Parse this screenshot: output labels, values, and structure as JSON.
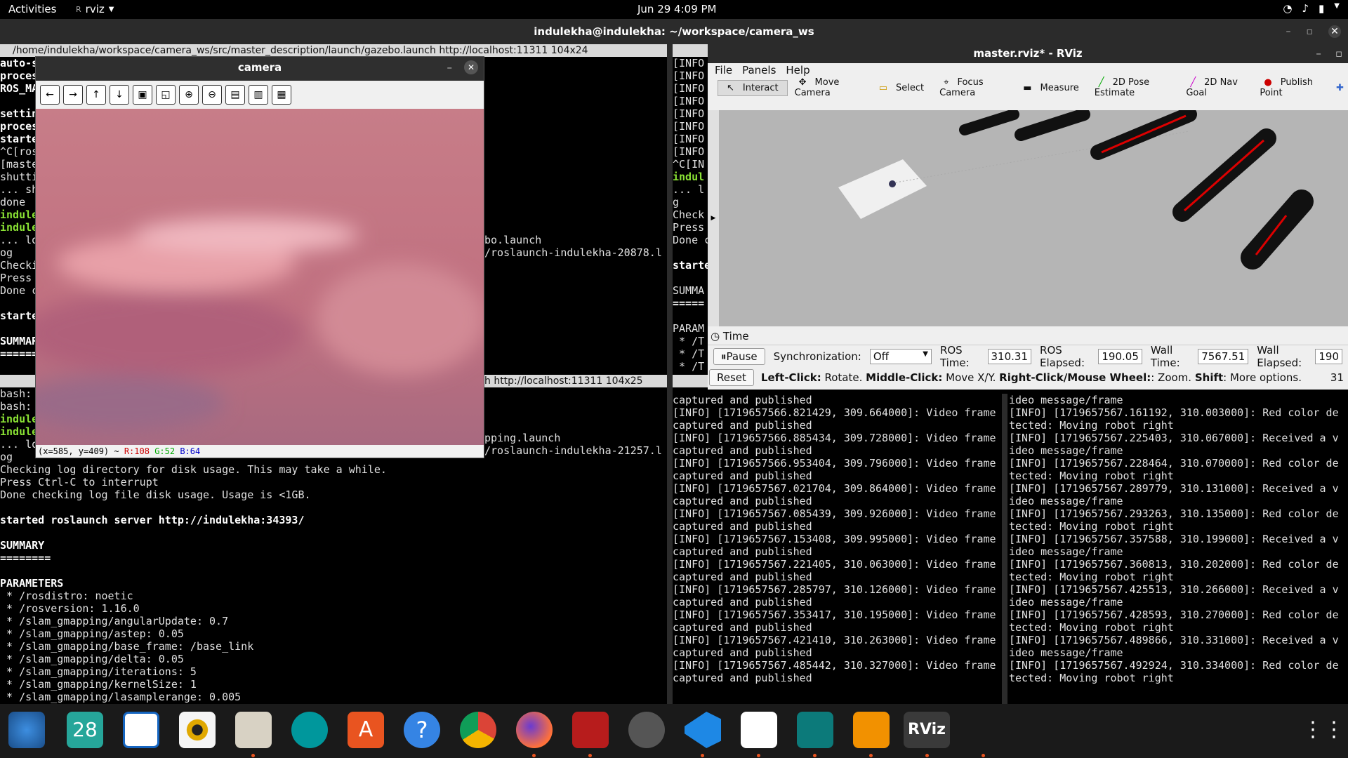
{
  "topbar": {
    "activities": "Activities",
    "app": "rviz",
    "clock": "Jun 29  4:09 PM"
  },
  "terminal_window": {
    "title": "indulekha@indulekha: ~/workspace/camera_ws"
  },
  "term1": {
    "header": "/home/indulekha/workspace/camera_ws/src/master_description/launch/gazebo.launch http://localhost:11311 104x24",
    "lines": [
      "auto-s",
      "proces",
      "ROS_MA",
      "",
      "settin",
      "proces",
      "starte",
      "^C[ros",
      "[maste",
      "shutti",
      "... sh",
      "done",
      "indule",
      "indule",
      "... lo",
      "og",
      "Checki",
      "Press",
      "Done c",
      "",
      "starte",
      "",
      "SUMMAR",
      "======"
    ],
    "right_lines": [
      "",
      "",
      "",
      "",
      "",
      "",
      "",
      "",
      "",
      "",
      "",
      "",
      "",
      "",
      "bo.launch",
      "/roslaunch-indulekha-20878.l"
    ]
  },
  "term2": {
    "header": "h http://localhost:11311 104x25",
    "lines": [
      "bash:",
      "bash:",
      "indule",
      "indule",
      "... lo",
      "og",
      "Checking log directory for disk usage. This may take a while.",
      "Press Ctrl-C to interrupt",
      "Done checking log file disk usage. Usage is <1GB.",
      "",
      "started roslaunch server http://indulekha:34393/",
      "",
      "SUMMARY",
      "========",
      "",
      "PARAMETERS",
      " * /rosdistro: noetic",
      " * /rosversion: 1.16.0",
      " * /slam_gmapping/angularUpdate: 0.7",
      " * /slam_gmapping/astep: 0.05",
      " * /slam_gmapping/base_frame: /base_link",
      " * /slam_gmapping/delta: 0.05",
      " * /slam_gmapping/iterations: 5",
      " * /slam_gmapping/kernelSize: 1",
      " * /slam_gmapping/lasamplerange: 0.005"
    ],
    "right_lines": [
      "pping.launch",
      "/roslaunch-indulekha-21257.l"
    ]
  },
  "term3": {
    "lines": [
      "[INFO",
      "[INFO",
      "[INFO",
      "[INFO",
      "[INFO",
      "[INFO",
      "[INFO",
      "[INFO",
      "^C[IN",
      "indul",
      "... l",
      "g",
      "Check",
      "Press",
      "Done c",
      "",
      "starte",
      "",
      "SUMMA",
      "=====",
      "",
      "PARAM",
      " * /T",
      " * /T",
      " * /T"
    ]
  },
  "term4": {
    "lines": [
      "captured and published",
      "[INFO] [1719657566.821429, 309.664000]: Video frame",
      "captured and published",
      "[INFO] [1719657566.885434, 309.728000]: Video frame",
      "captured and published",
      "[INFO] [1719657566.953404, 309.796000]: Video frame",
      "captured and published",
      "[INFO] [1719657567.021704, 309.864000]: Video frame",
      "captured and published",
      "[INFO] [1719657567.085439, 309.926000]: Video frame",
      "captured and published",
      "[INFO] [1719657567.153408, 309.995000]: Video frame",
      "captured and published",
      "[INFO] [1719657567.221405, 310.063000]: Video frame",
      "captured and published",
      "[INFO] [1719657567.285797, 310.126000]: Video frame",
      "captured and published",
      "[INFO] [1719657567.353417, 310.195000]: Video frame",
      "captured and published",
      "[INFO] [1719657567.421410, 310.263000]: Video frame",
      "captured and published",
      "[INFO] [1719657567.485442, 310.327000]: Video frame",
      "captured and published"
    ]
  },
  "term5": {
    "lines": [
      "ideo message/frame",
      "[INFO] [1719657567.161192, 310.003000]: Red color de",
      "tected: Moving robot right",
      "[INFO] [1719657567.225403, 310.067000]: Received a v",
      "ideo message/frame",
      "[INFO] [1719657567.228464, 310.070000]: Red color de",
      "tected: Moving robot right",
      "[INFO] [1719657567.289779, 310.131000]: Received a v",
      "ideo message/frame",
      "[INFO] [1719657567.293263, 310.135000]: Red color de",
      "tected: Moving robot right",
      "[INFO] [1719657567.357588, 310.199000]: Received a v",
      "ideo message/frame",
      "[INFO] [1719657567.360813, 310.202000]: Red color de",
      "tected: Moving robot right",
      "[INFO] [1719657567.425513, 310.266000]: Received a v",
      "ideo message/frame",
      "[INFO] [1719657567.428593, 310.270000]: Red color de",
      "tected: Moving robot right",
      "[INFO] [1719657567.489866, 310.331000]: Received a v",
      "ideo message/frame",
      "[INFO] [1719657567.492924, 310.334000]: Red color de",
      "tected: Moving robot right"
    ]
  },
  "camera": {
    "title": "camera",
    "status_pos": "(x=585, y=409) ~ ",
    "status_r": "R:108",
    "status_g": "G:52",
    "status_b": "B:64"
  },
  "rviz": {
    "title": "master.rviz* - RViz",
    "menu": [
      "File",
      "Panels",
      "Help"
    ],
    "tools": [
      "Interact",
      "Move Camera",
      "Select",
      "Focus Camera",
      "Measure",
      "2D Pose Estimate",
      "2D Nav Goal",
      "Publish Point"
    ],
    "time_label": "Time",
    "pause": "Pause",
    "sync_label": "Synchronization:",
    "sync_value": "Off",
    "ros_time_label": "ROS Time:",
    "ros_time": "310.31",
    "ros_elapsed_label": "ROS Elapsed:",
    "ros_elapsed": "190.05",
    "wall_time_label": "Wall Time:",
    "wall_time": "7567.51",
    "wall_elapsed_label": "Wall Elapsed:",
    "wall_elapsed": "190",
    "reset": "Reset",
    "help_1": "Left-Click:",
    "help_2": " Rotate. ",
    "help_3": "Middle-Click:",
    "help_4": " Move X/Y. ",
    "help_5": "Right-Click/Mouse Wheel:",
    "help_6": ": Zoom. ",
    "help_7": "Shift",
    "help_8": ": More options.",
    "fps": "31"
  },
  "dock": {
    "calendar_day": "28",
    "rviz_label": "RViz"
  }
}
